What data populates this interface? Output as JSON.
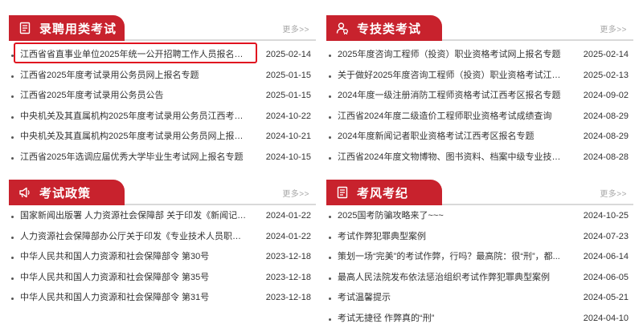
{
  "colors": {
    "tab_bg": "#c8222d",
    "highlight_border": "#e0121f",
    "more_text": "#a8a8a8"
  },
  "panels": [
    {
      "title": "录聘用类考试",
      "icon": "document-icon",
      "more": "更多>>",
      "items": [
        {
          "title": "江西省省直事业单位2025年统一公开招聘工作人员报名专题",
          "date": "2025-02-14"
        },
        {
          "title": "江西省2025年度考试录用公务员网上报名专题",
          "date": "2025-01-15"
        },
        {
          "title": "江西省2025年度考试录用公务员公告",
          "date": "2025-01-15"
        },
        {
          "title": "中央机关及其直属机构2025年度考试录用公务员江西考区报...",
          "date": "2024-10-22"
        },
        {
          "title": "中央机关及其直属机构2025年度考试录用公务员网上报名专题",
          "date": "2024-10-21"
        },
        {
          "title": "江西省2025年选调应届优秀大学毕业生考试网上报名专题",
          "date": "2024-10-15"
        }
      ]
    },
    {
      "title": "专技类考试",
      "icon": "user-certificate-icon",
      "more": "更多>>",
      "items": [
        {
          "title": "2025年度咨询工程师（投资）职业资格考试网上报名专题",
          "date": "2025-02-14"
        },
        {
          "title": "关于做好2025年度咨询工程师（投资）职业资格考试江西考...",
          "date": "2025-02-13"
        },
        {
          "title": "2024年度一级注册消防工程师资格考试江西考区报名专题",
          "date": "2024-09-02"
        },
        {
          "title": "江西省2024年度二级造价工程师职业资格考试成绩查询",
          "date": "2024-08-29"
        },
        {
          "title": "2024年度新闻记者职业资格考试江西考区报名专题",
          "date": "2024-08-29"
        },
        {
          "title": "江西省2024年度文物博物、图书资料、档案中级专业技术资...",
          "date": "2024-08-28"
        }
      ]
    },
    {
      "title": "考试政策",
      "icon": "megaphone-icon",
      "more": "更多>>",
      "items": [
        {
          "title": "国家新闻出版署 人力资源社会保障部 关于印发《新闻记者职...",
          "date": "2024-01-22"
        },
        {
          "title": "人力资源社会保障部办公厅关于印发《专业技术人员职业资格...",
          "date": "2024-01-22"
        },
        {
          "title": "中华人民共和国人力资源和社会保障部令 第30号",
          "date": "2023-12-18"
        },
        {
          "title": "中华人民共和国人力资源和社会保障部令 第35号",
          "date": "2023-12-18"
        },
        {
          "title": "中华人民共和国人力资源和社会保障部令 第31号",
          "date": "2023-12-18"
        }
      ]
    },
    {
      "title": "考风考纪",
      "icon": "document-icon",
      "more": "更多>>",
      "items": [
        {
          "title": "2025国考防骗攻略来了~~~",
          "date": "2024-10-25"
        },
        {
          "title": "考试作弊犯罪典型案例",
          "date": "2024-07-23"
        },
        {
          "title": "策划一场“完美”的考试作弊，行吗？最高院：很“刑”，都...",
          "date": "2024-06-14"
        },
        {
          "title": "最高人民法院发布依法惩治组织考试作弊犯罪典型案例",
          "date": "2024-06-05"
        },
        {
          "title": "考试温馨提示",
          "date": "2024-05-21"
        },
        {
          "title": "考试无捷径 作弊真的“刑”",
          "date": "2024-04-10"
        }
      ]
    }
  ]
}
